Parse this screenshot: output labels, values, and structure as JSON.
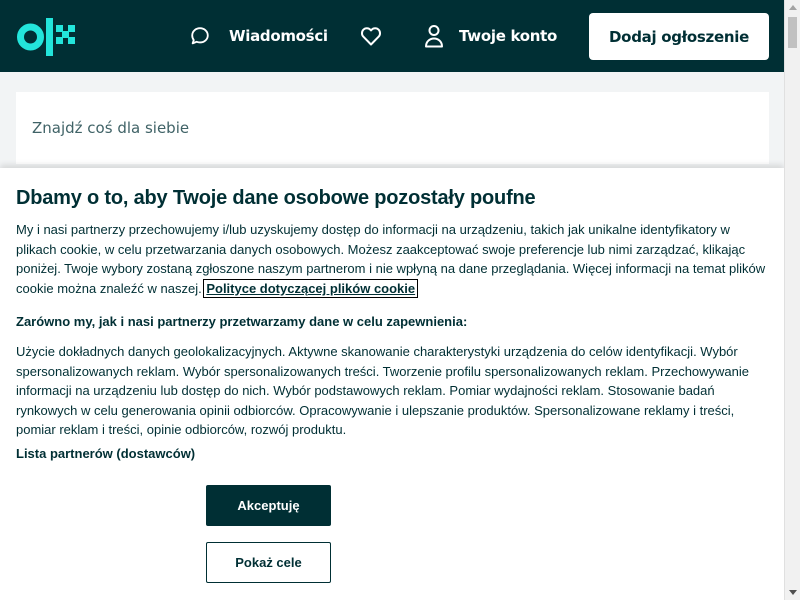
{
  "header": {
    "logo_alt": "olx",
    "messages_label": "Wiadomości",
    "favorites_icon": "heart-icon",
    "account_label": "Twoje konto",
    "add_listing_label": "Dodaj ogłoszenie",
    "colors": {
      "background": "#002f34",
      "logo": "#23e5db",
      "text": "#ffffff"
    }
  },
  "search": {
    "placeholder": "Znajdź coś dla siebie"
  },
  "consent": {
    "title": "Dbamy o to, aby Twoje dane osobowe pozostały poufne",
    "description": "My i nasi partnerzy przechowujemy i/lub uzyskujemy dostęp do informacji na urządzeniu, takich jak unikalne identyfikatory w plikach cookie, w celu przetwarzania danych osobowych. Możesz zaakceptować swoje preferencje lub nimi zarządzać, klikając poniżej. Twoje wybory zostaną zgłoszone naszym partnerom i nie wpłyną na dane przeglądania. Więcej informacji na temat plików cookie można znaleźć w naszej.",
    "cookie_policy_link": "Polityce dotyczącej plików cookie",
    "subtitle": "Zarówno my, jak i nasi partnerzy przetwarzamy dane w celu zapewnienia:",
    "purposes": "Użycie dokładnych danych geolokalizacyjnych. Aktywne skanowanie charakterystyki urządzenia do celów identyfikacji. Wybór spersonalizowanych reklam. Wybór spersonalizowanych treści. Tworzenie profilu spersonalizowanych reklam. Przechowywanie informacji na urządzeniu lub dostęp do nich. Wybór podstawowych reklam. Pomiar wydajności reklam. Stosowanie badań rynkowych w celu generowania opinii odbiorców. Opracowywanie i ulepszanie produktów. Spersonalizowane reklamy i treści, pomiar reklam i treści, opinie odbiorców, rozwój produktu.",
    "partners_link": "Lista partnerów (dostawców)",
    "accept_label": "Akceptuję",
    "show_purposes_label": "Pokaż cele"
  }
}
